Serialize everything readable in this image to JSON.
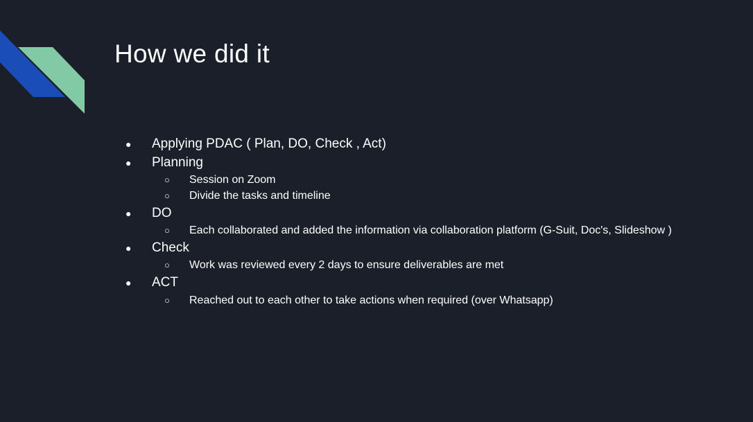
{
  "slide": {
    "title": "How we did it",
    "decor_icon": "diagonal-stripes-logo",
    "colors": {
      "background": "#1b1f2a",
      "stripe_blue": "#1a4db8",
      "stripe_green": "#82c9a5",
      "text": "#ffffff"
    },
    "bullet_marker": "●",
    "sub_bullet_marker": "○",
    "items": [
      {
        "text": "Applying PDAC ( Plan, DO, Check , Act)"
      },
      {
        "text": "Planning"
      },
      {
        "text": "Session on Zoom"
      },
      {
        "text": "Divide the tasks and timeline"
      },
      {
        "text": "DO"
      },
      {
        "text": "Each collaborated and added the information via collaboration platform (G-Suit, Doc's, Slideshow )"
      },
      {
        "text": "Check"
      },
      {
        "text": "Work was reviewed every 2 days to ensure deliverables are met"
      },
      {
        "text": "ACT"
      },
      {
        "text": "Reached out to each other to take actions when required (over Whatsapp)"
      }
    ]
  }
}
